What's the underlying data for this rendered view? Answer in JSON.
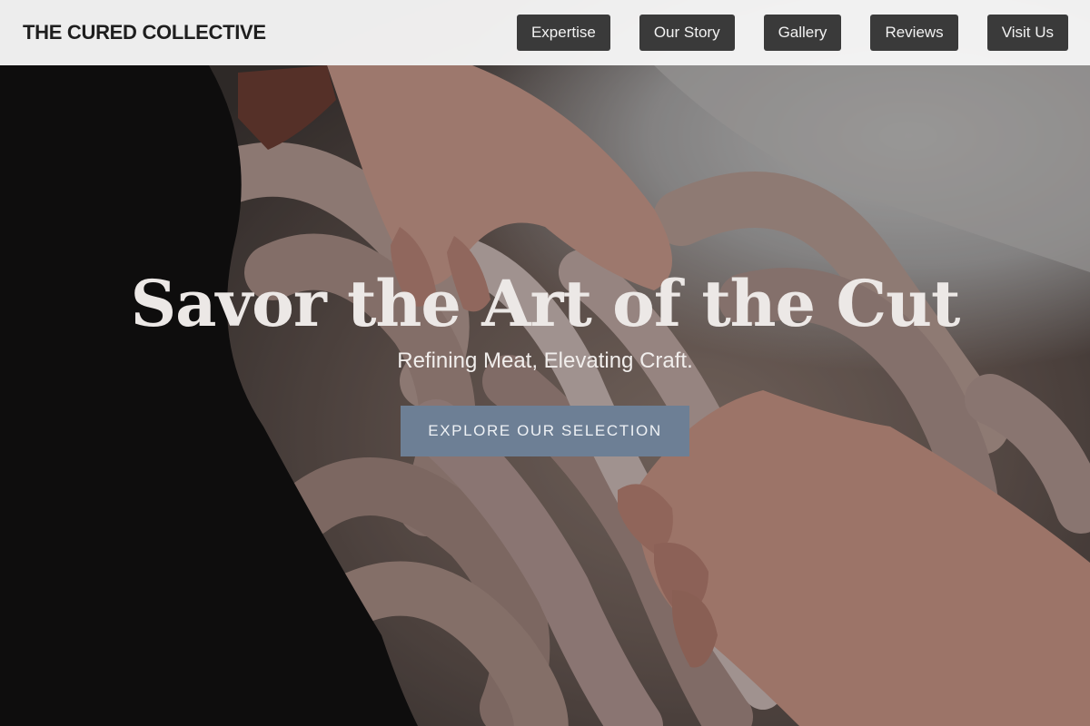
{
  "nav": {
    "brand": "THE CURED COLLECTIVE",
    "links": [
      {
        "label": "Expertise"
      },
      {
        "label": "Our Story"
      },
      {
        "label": "Gallery"
      },
      {
        "label": "Reviews"
      },
      {
        "label": "Visit Us"
      }
    ]
  },
  "hero": {
    "title": "Savor the Art of the Cut",
    "subtitle": "Refining Meat, Elevating Craft.",
    "cta_label": "EXPLORE OUR SELECTION"
  },
  "colors": {
    "nav_button_bg": "#3a3a3a",
    "cta_bg": "#6d7f95",
    "nav_bar_bg": "#f6f6f6"
  }
}
